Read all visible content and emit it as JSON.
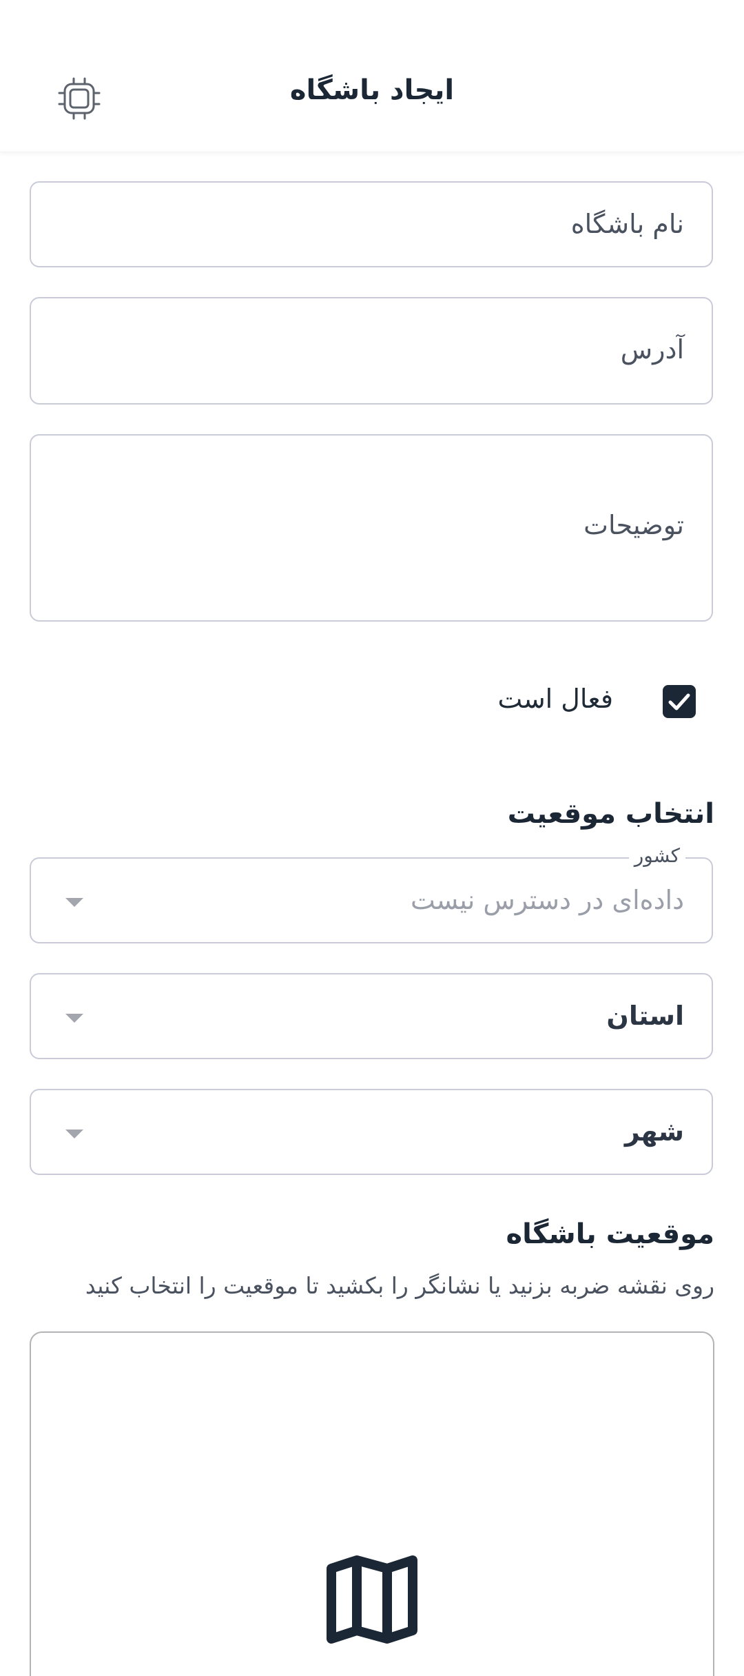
{
  "app_bar": {
    "title": "ایجاد باشگاه",
    "icon": "chip-icon"
  },
  "form": {
    "name_placeholder": "نام باشگاه",
    "address_placeholder": "آدرس",
    "description_placeholder": "توضیحات",
    "active_label": "فعال است",
    "active_checked": true
  },
  "location": {
    "section_title": "انتخاب موقعیت",
    "country_label": "کشور",
    "country_value": "داده‌ای در دسترس نیست",
    "province_label": "استان",
    "city_label": "شهر"
  },
  "map": {
    "section_title": "موقعیت باشگاه",
    "hint": "روی نقشه ضربه بزنید یا نشانگر را بکشید تا موقعیت را انتخاب کنید",
    "icon": "map-icon"
  },
  "colors": {
    "primary": "#1b2735",
    "border": "#c9cbd8",
    "muted_text": "#9a9ea8"
  }
}
